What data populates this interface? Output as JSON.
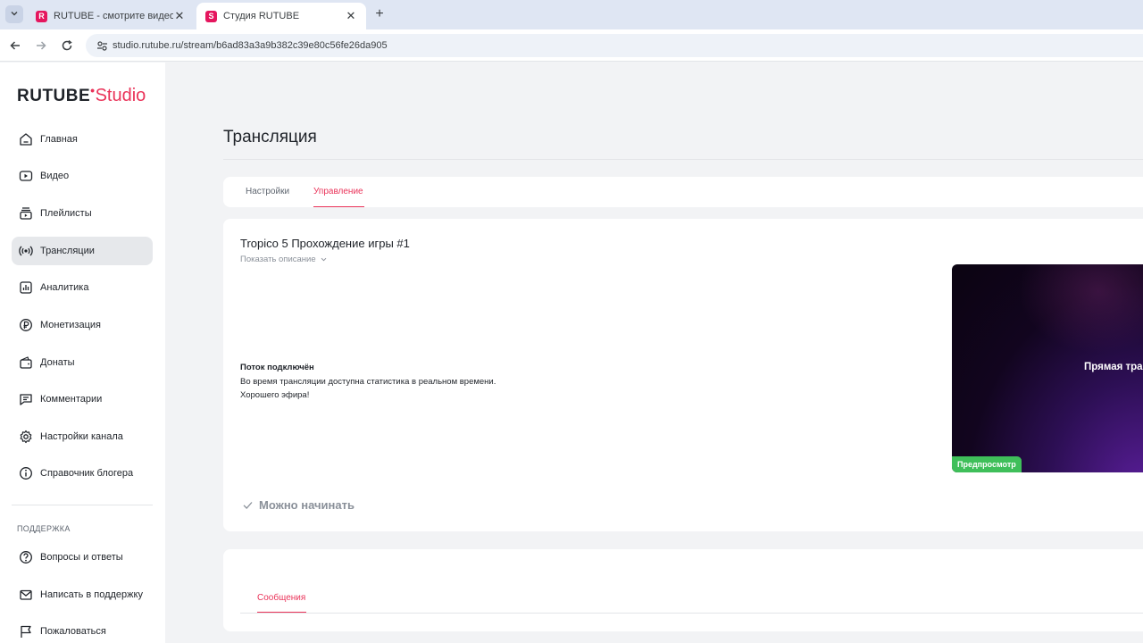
{
  "browser": {
    "tabs": [
      {
        "title": "RUTUBE - смотрите видео онл",
        "favicon": "rutube-favicon",
        "color": "#e5165e",
        "glyph": "R"
      },
      {
        "title": "Студия RUTUBE",
        "favicon": "rutube-studio-favicon",
        "color": "#e5165e",
        "glyph": "S"
      }
    ],
    "url": "studio.rutube.ru/stream/b6ad83a3a9b382c39e80c56fe26da905"
  },
  "logo": {
    "brand": "RUTUBE",
    "suffix": "Studio"
  },
  "sidebar": {
    "items": [
      {
        "label": "Главная",
        "icon": "home-icon"
      },
      {
        "label": "Видео",
        "icon": "video-icon"
      },
      {
        "label": "Плейлисты",
        "icon": "playlist-icon"
      },
      {
        "label": "Трансляции",
        "icon": "broadcast-icon",
        "active": true
      },
      {
        "label": "Аналитика",
        "icon": "analytics-icon"
      },
      {
        "label": "Монетизация",
        "icon": "ruble-icon"
      },
      {
        "label": "Донаты",
        "icon": "wallet-icon"
      },
      {
        "label": "Комментарии",
        "icon": "comment-icon"
      },
      {
        "label": "Настройки канала",
        "icon": "gear-icon"
      },
      {
        "label": "Справочник блогера",
        "icon": "info-icon"
      }
    ],
    "support_heading": "ПОДДЕРЖКА",
    "support_items": [
      {
        "label": "Вопросы и ответы",
        "icon": "question-icon"
      },
      {
        "label": "Написать в поддержку",
        "icon": "mail-icon"
      },
      {
        "label": "Пожаловаться",
        "icon": "flag-icon"
      }
    ]
  },
  "page": {
    "title": "Трансляция",
    "tabs": [
      {
        "label": "Настройки",
        "active": false
      },
      {
        "label": "Управление",
        "active": true
      }
    ]
  },
  "stream": {
    "title": "Tropico 5 Прохождение игры #1",
    "show_description": "Показать описание",
    "status_title": "Поток подключён",
    "status_line1": "Во время трансляции доступна статистика в реальном времени.",
    "status_line2": "Хорошего эфира!",
    "ready_label": "Можно начинать",
    "preview_text": "Прямая трансляция",
    "preview_badge": "Предпросмотр"
  },
  "messages": {
    "tab_label": "Сообщения"
  },
  "colors": {
    "accent": "#ea3359",
    "badge": "#3fbf5a"
  }
}
